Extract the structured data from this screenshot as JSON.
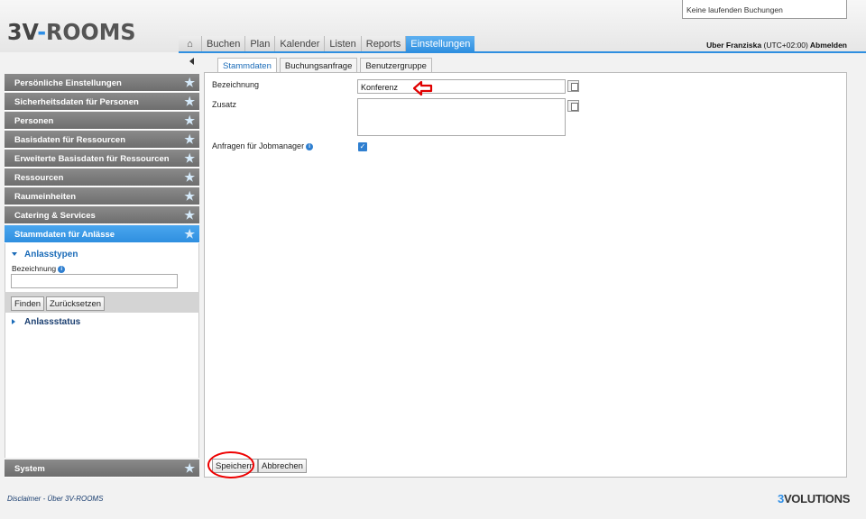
{
  "header": {
    "logo_main": "3V",
    "logo_sep": "-",
    "logo_rest": "ROOMS",
    "bookings_status": "Keine laufenden Buchungen",
    "user": "Uber Franziska",
    "timezone": "(UTC+02:00)",
    "logout": "Abmelden"
  },
  "nav": {
    "home_icon": "⌂",
    "tabs": [
      "Buchen",
      "Plan",
      "Kalender",
      "Listen",
      "Reports",
      "Einstellungen"
    ],
    "active": "Einstellungen"
  },
  "sidebar": {
    "items": [
      {
        "label": "Persönliche Einstellungen"
      },
      {
        "label": "Sicherheitsdaten für Personen"
      },
      {
        "label": "Personen"
      },
      {
        "label": "Basisdaten für Ressourcen"
      },
      {
        "label": "Erweiterte Basisdaten für Ressourcen"
      },
      {
        "label": "Ressourcen"
      },
      {
        "label": "Raumeinheiten"
      },
      {
        "label": "Catering & Services"
      },
      {
        "label": "Stammdaten für Anlässe"
      }
    ],
    "system_label": "System",
    "star_icon": "★",
    "sub": {
      "types_header": "Anlasstypen",
      "field_label": "Bezeichnung",
      "find_button": "Finden",
      "reset_button": "Zurücksetzen",
      "status_header": "Anlassstatus"
    }
  },
  "content": {
    "tabs": [
      "Stammdaten",
      "Buchungsanfrage",
      "Benutzergruppe"
    ],
    "fields": {
      "name_label": "Bezeichnung",
      "name_value": "Konferenz",
      "extra_label": "Zusatz",
      "extra_value": "",
      "jobmanager_label": "Anfragen für Jobmanager",
      "jobmanager_checked": true,
      "check_glyph": "✓"
    },
    "save_button": "Speichern",
    "cancel_button": "Abbrechen"
  },
  "footer": {
    "disclaimer": "Disclaimer",
    "separator": "-",
    "about": "Über 3V-ROOMS",
    "brand_e": "3",
    "brand_rest": "VOLUTIONS"
  },
  "colors": {
    "accent": "#2f8fe0",
    "annotation": "#e00000"
  }
}
